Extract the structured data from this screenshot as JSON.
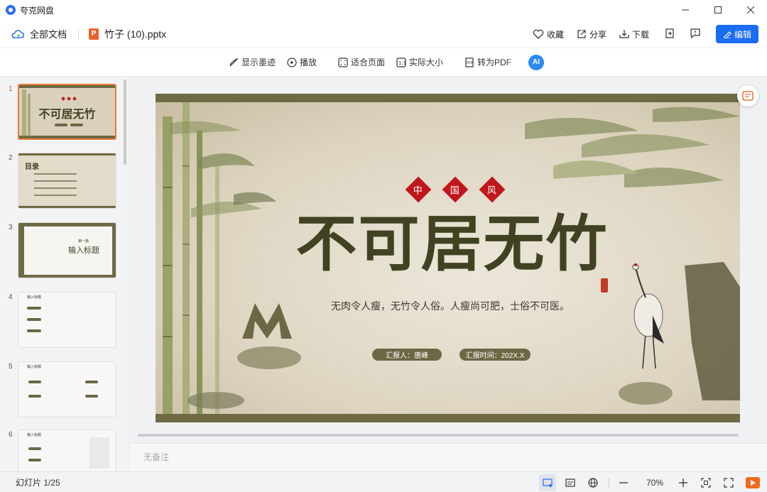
{
  "app": {
    "name": "夸克网盘",
    "icon": "quark-logo-icon"
  },
  "window_controls": [
    "minimize-icon",
    "maximize-icon",
    "close-icon"
  ],
  "docbar": {
    "all_docs_label": "全部文档",
    "file_name": "竹子 (10).pptx",
    "file_type_letter": "P",
    "actions": {
      "favorite": "收藏",
      "share": "分享",
      "download": "下载",
      "edit": "编辑"
    }
  },
  "toolbar": {
    "ink": "显示墨迹",
    "play": "播放",
    "fit_page": "适合页面",
    "actual_size": "实际大小",
    "to_pdf": "转为PDF",
    "ai": "AI"
  },
  "slide": {
    "tags": [
      "中",
      "国",
      "风"
    ],
    "title": "不可居无竹",
    "subtitle": "无肉令人瘦，无竹令人俗。人瘦尚可肥，士俗不可医。",
    "reporter": "汇报人：唐峰",
    "report_time": "汇报时间：202X.X"
  },
  "thumbnails": [
    {
      "num": "1",
      "label": "不可居无竹",
      "active": true
    },
    {
      "num": "2",
      "label": "目录",
      "active": false
    },
    {
      "num": "3",
      "label": "输入标题",
      "kicker": "第一篇",
      "active": false
    },
    {
      "num": "4",
      "label": "输入标题",
      "active": false
    },
    {
      "num": "5",
      "label": "输入标题",
      "active": false
    },
    {
      "num": "6",
      "label": "输入标题",
      "active": false
    }
  ],
  "notes_placeholder": "无备注",
  "status": {
    "slide_count": "幻灯片 1/25",
    "zoom": "70%"
  },
  "colors": {
    "accent": "#1a6cf5",
    "slide_olive": "#6e6a43",
    "slide_red": "#c0171c",
    "active_thumb": "#f07a34"
  }
}
